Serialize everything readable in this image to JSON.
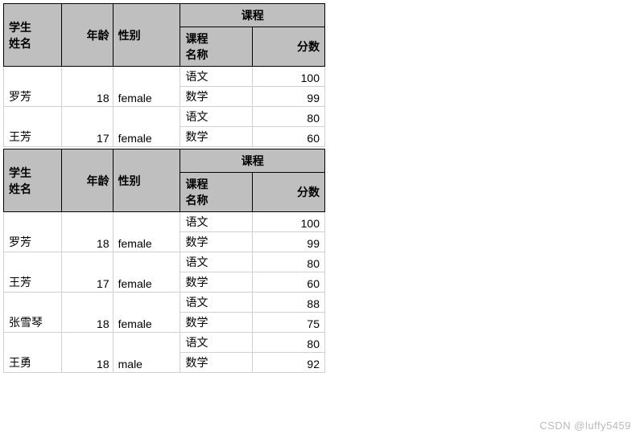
{
  "chart_data": [
    {
      "type": "table",
      "title": "",
      "columns": [
        "学生姓名",
        "年龄",
        "性别",
        "课程名称",
        "分数"
      ],
      "column_group": {
        "课程": [
          "课程名称",
          "分数"
        ]
      },
      "rows": [
        {
          "name": "罗芳",
          "age": 18,
          "gender": "female",
          "courses": [
            {
              "course": "语文",
              "score": 100
            },
            {
              "course": "数学",
              "score": 99
            }
          ]
        },
        {
          "name": "王芳",
          "age": 17,
          "gender": "female",
          "courses": [
            {
              "course": "语文",
              "score": 80
            },
            {
              "course": "数学",
              "score": 60
            }
          ]
        }
      ]
    },
    {
      "type": "table",
      "title": "",
      "columns": [
        "学生姓名",
        "年龄",
        "性别",
        "课程名称",
        "分数"
      ],
      "column_group": {
        "课程": [
          "课程名称",
          "分数"
        ]
      },
      "rows": [
        {
          "name": "罗芳",
          "age": 18,
          "gender": "female",
          "courses": [
            {
              "course": "语文",
              "score": 100
            },
            {
              "course": "数学",
              "score": 99
            }
          ]
        },
        {
          "name": "王芳",
          "age": 17,
          "gender": "female",
          "courses": [
            {
              "course": "语文",
              "score": 80
            },
            {
              "course": "数学",
              "score": 60
            }
          ]
        },
        {
          "name": "张雪琴",
          "age": 18,
          "gender": "female",
          "courses": [
            {
              "course": "语文",
              "score": 88
            },
            {
              "course": "数学",
              "score": 75
            }
          ]
        },
        {
          "name": "王勇",
          "age": 18,
          "gender": "male",
          "courses": [
            {
              "course": "语文",
              "score": 80
            },
            {
              "course": "数学",
              "score": 92
            }
          ]
        }
      ]
    }
  ],
  "headers": {
    "name": "学生\n姓名",
    "age": "年龄",
    "gender": "性别",
    "course_group": "课程",
    "course_name": "课程\n名称",
    "score": "分数"
  },
  "watermark": "CSDN @luffy5459"
}
